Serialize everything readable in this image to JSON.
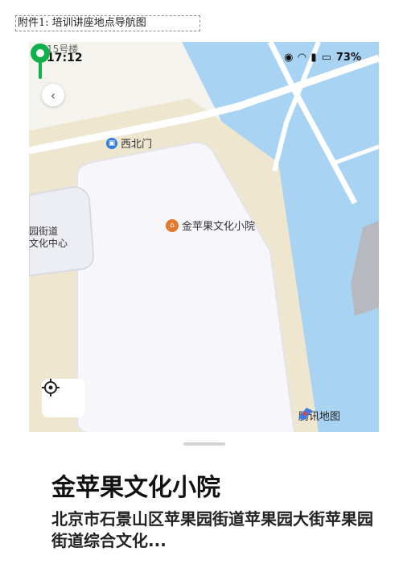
{
  "caption": "附件1: 培训讲座地点导航图",
  "status": {
    "top_text": "15号楼",
    "time": "17:12",
    "battery": "73%"
  },
  "map": {
    "gate_label": "西北门",
    "left_poi_line1": "园街道",
    "left_poi_line2": "文化中心",
    "main_poi_label": "金苹果文化小院",
    "brand": "腾讯地图"
  },
  "sheet": {
    "name": "金苹果文化小院",
    "address": "北京市石景山区苹果园街道苹果园大街苹果园街道综合文化..."
  },
  "colors": {
    "pin": "#12b04b",
    "water": "#a9d3f2",
    "gate_icon": "#2f7de1",
    "poi_icon": "#e07a2f"
  }
}
